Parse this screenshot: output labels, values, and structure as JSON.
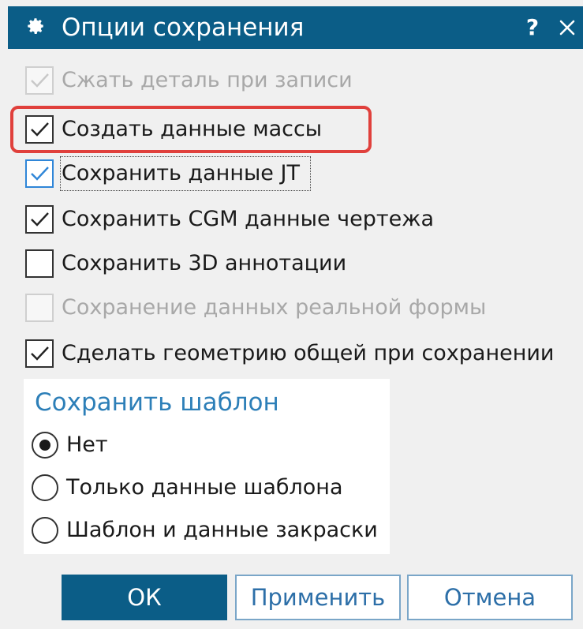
{
  "dialog": {
    "title": "Опции сохранения",
    "help_label": "?",
    "icon": "gear-icon",
    "close_icon": "close-icon"
  },
  "options": [
    {
      "label": "Сжать деталь при записи",
      "checked": true,
      "enabled": false
    },
    {
      "label": "Создать данные массы",
      "checked": true,
      "enabled": true,
      "highlighted": true
    },
    {
      "label": "Сохранить данные JT",
      "checked": true,
      "enabled": true,
      "focused": true
    },
    {
      "label": "Сохранить CGM данные чертежа",
      "checked": true,
      "enabled": true
    },
    {
      "label": "Сохранить 3D аннотации",
      "checked": false,
      "enabled": true
    },
    {
      "label": "Сохранение данных реальной формы",
      "checked": false,
      "enabled": false
    },
    {
      "label": "Сделать геометрию общей при сохранении",
      "checked": true,
      "enabled": true
    }
  ],
  "template_group": {
    "title": "Сохранить шаблон",
    "choices": [
      {
        "label": "Нет",
        "selected": true
      },
      {
        "label": "Только данные шаблона",
        "selected": false
      },
      {
        "label": "Шаблон и данные закраски",
        "selected": false
      }
    ]
  },
  "buttons": {
    "ok": "ОК",
    "apply": "Применить",
    "cancel": "Отмена"
  },
  "colors": {
    "titlebar": "#0b5d87",
    "highlight": "#e0403c",
    "group_title": "#2d7fb8"
  }
}
